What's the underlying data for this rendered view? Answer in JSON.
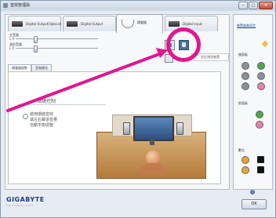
{
  "window": {
    "title": "音效管理員",
    "buttons": {
      "minimize": "–",
      "maximize": "□",
      "close": "✕"
    }
  },
  "tabs": [
    {
      "label": "Digital Output(Optical)"
    },
    {
      "label": "Digital Output"
    },
    {
      "label": "揚聲器"
    },
    {
      "label": "Digital Input"
    }
  ],
  "volume": {
    "main_label": "主音量",
    "wave_label": "波形音量",
    "lr_label": "L      R",
    "main_level_pct": 22,
    "wave_level_pct": 22
  },
  "tooltip_text": "設定預設裝置",
  "subtabs": [
    "揚聲器組態",
    "音效模式"
  ],
  "content": {
    "section_title": "環繞控制",
    "option_text": "啟用環繞音效\n讓左右聲道音量\n自動平衡調整"
  },
  "right_panel": {
    "link": "裝置進階設定",
    "rear_label": "後面板",
    "front_label": "前面板",
    "digital_label": "數位"
  },
  "footer": {
    "brand": "GIGABYTE",
    "tagline": "TECHNOLOGY",
    "help": "i",
    "ok": "OK"
  },
  "colors": {
    "highlight": "#e2168f",
    "jack_green": "#4aa84a",
    "jack_pink": "#e57fb2",
    "jack_gray": "#8a9099"
  }
}
